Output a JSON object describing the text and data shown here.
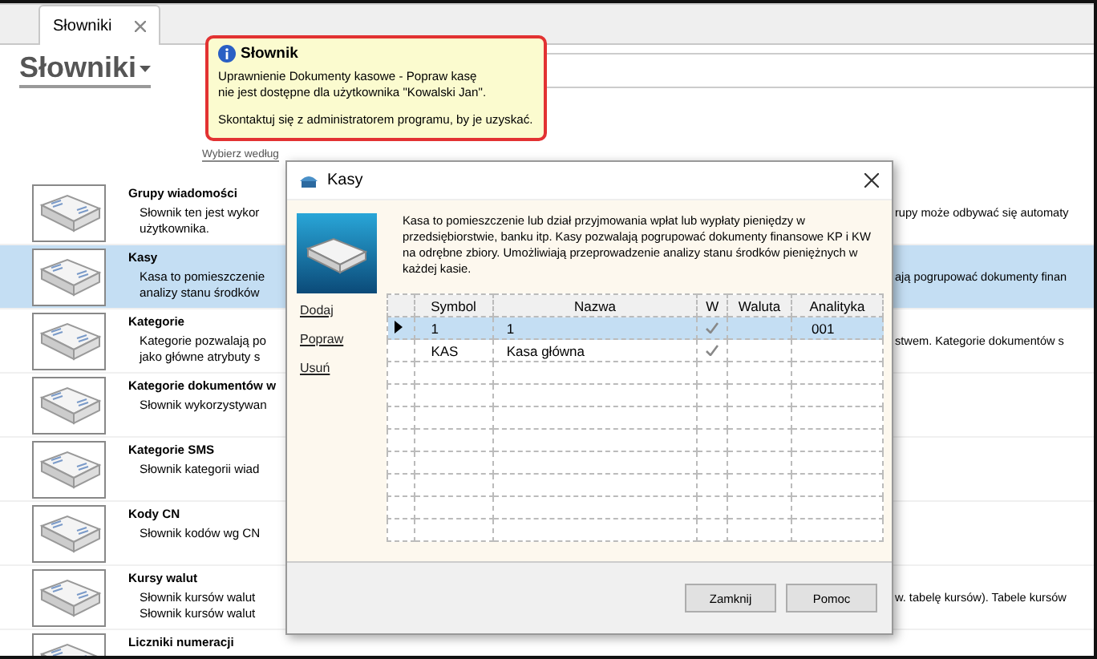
{
  "tabs": [
    {
      "label": "Słowniki",
      "selected": true
    }
  ],
  "heading": "Słowniki",
  "filter_link": "Wybierz według",
  "list": [
    {
      "title": "Grupy wiadomości",
      "lines": [
        "Słownik ten jest wykor",
        "użytkownika."
      ],
      "right": "rupy może odbywać się automaty",
      "selected": false
    },
    {
      "title": "Kasy",
      "lines": [
        "Kasa to pomieszczenie",
        "analizy stanu środków"
      ],
      "right": "ają pogrupować dokumenty finan",
      "selected": true
    },
    {
      "title": "Kategorie",
      "lines": [
        "Kategorie pozwalają po",
        "jako główne atrybuty s"
      ],
      "right": "stwem. Kategorie dokumentów s",
      "selected": false
    },
    {
      "title": "Kategorie dokumentów w",
      "lines": [
        "Słownik wykorzystywan"
      ],
      "selected": false
    },
    {
      "title": "Kategorie SMS",
      "lines": [
        "Słownik kategorii wiad"
      ],
      "selected": false
    },
    {
      "title": "Kody CN",
      "lines": [
        "Słownik kodów wg CN"
      ],
      "selected": false
    },
    {
      "title": "Kursy walut",
      "lines": [
        "Słownik kursów walut",
        "Słownik kursów walut"
      ],
      "right": "w. tabelę kursów). Tabele kursów",
      "selected": false
    },
    {
      "title": "Liczniki numeracji",
      "selected": false
    }
  ],
  "tooltip": {
    "title": "Słownik",
    "lines": [
      "Uprawnienie Dokumenty kasowe - Popraw kasę",
      "nie jest dostępne dla użytkownika \"Kowalski Jan\"."
    ],
    "footer": "Skontaktuj się z administratorem programu, by je uzyskać."
  },
  "dialog": {
    "title": "Kasy",
    "description": "Kasa to pomieszczenie lub dział przyjmowania wpłat lub wypłaty pieniędzy w przedsiębiorstwie, banku itp. Kasy pozwalają pogrupować dokumenty finansowe KP i KW na odrębne zbiory. Umożliwiają przeprowadzenie analizy stanu środków pieniężnych w każdej kasie.",
    "actions": [
      "Dodaj",
      "Popraw",
      "Usuń"
    ],
    "columns": [
      "Symbol",
      "Nazwa",
      "W",
      "Waluta",
      "Analityka"
    ],
    "rows": [
      {
        "symbol": "1",
        "name": "1",
        "checked": true,
        "analityka": "001",
        "selected": true
      },
      {
        "symbol": "KAS",
        "name": "Kasa główna",
        "checked": true,
        "selected": false
      }
    ],
    "buttons": [
      "Zamknij",
      "Pomoc"
    ]
  }
}
